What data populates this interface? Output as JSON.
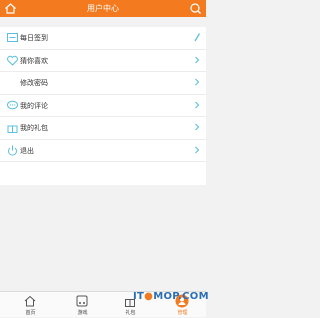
{
  "header": {
    "title": "用户中心",
    "bg_color": "#f47a1f"
  },
  "menu": {
    "items": [
      {
        "label": "每日签到",
        "icon": "checkin-icon"
      },
      {
        "label": "猜你喜欢",
        "icon": "heart-icon"
      },
      {
        "label": "修改密码",
        "icon": ""
      },
      {
        "label": "我的评论",
        "icon": "comment-icon"
      },
      {
        "label": "我的礼包",
        "icon": "gift-icon"
      },
      {
        "label": "退出",
        "icon": "power-icon"
      }
    ]
  },
  "bottom_nav": {
    "tabs": [
      {
        "label": "首页",
        "icon": "home-icon"
      },
      {
        "label": "游戏",
        "icon": "gamepad-icon"
      },
      {
        "label": "礼包",
        "icon": "gift-icon"
      },
      {
        "label": "管理",
        "icon": "user-icon",
        "active": true
      }
    ]
  },
  "watermark": {
    "text_before_dot": "IT",
    "text_after_dot": "MOP.COM"
  }
}
